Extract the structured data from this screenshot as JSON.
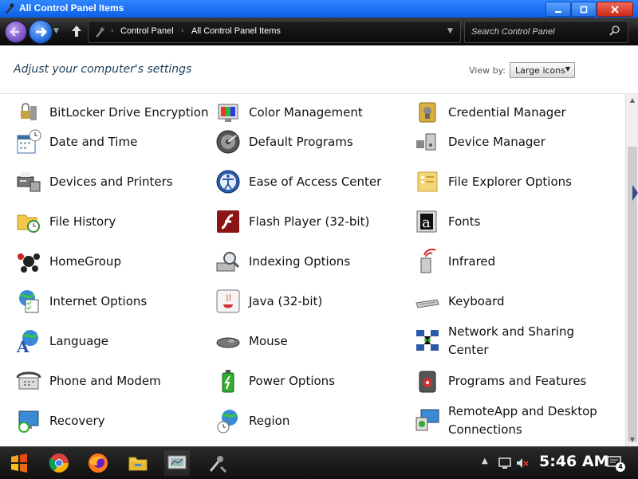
{
  "window": {
    "title": "All Control Panel Items"
  },
  "address": {
    "crumbs": [
      "Control Panel",
      "All Control Panel Items"
    ],
    "search_placeholder": "Search Control Panel"
  },
  "header": {
    "heading": "Adjust your computer's settings",
    "view_by_label": "View by:",
    "view_by_value": "Large icons"
  },
  "items": [
    {
      "label": "BitLocker Drive Encryption",
      "icon": "bitlocker-icon"
    },
    {
      "label": "Color Management",
      "icon": "color-management-icon"
    },
    {
      "label": "Credential Manager",
      "icon": "credential-manager-icon"
    },
    {
      "label": "Date and Time",
      "icon": "date-time-icon"
    },
    {
      "label": "Default Programs",
      "icon": "default-programs-icon"
    },
    {
      "label": "Device Manager",
      "icon": "device-manager-icon"
    },
    {
      "label": "Devices and Printers",
      "icon": "devices-printers-icon"
    },
    {
      "label": "Ease of Access Center",
      "icon": "ease-of-access-icon"
    },
    {
      "label": "File Explorer Options",
      "icon": "file-explorer-options-icon"
    },
    {
      "label": "File History",
      "icon": "file-history-icon"
    },
    {
      "label": "Flash Player (32-bit)",
      "icon": "flash-player-icon"
    },
    {
      "label": "Fonts",
      "icon": "fonts-icon"
    },
    {
      "label": "HomeGroup",
      "icon": "homegroup-icon"
    },
    {
      "label": "Indexing Options",
      "icon": "indexing-options-icon"
    },
    {
      "label": "Infrared",
      "icon": "infrared-icon"
    },
    {
      "label": "Internet Options",
      "icon": "internet-options-icon"
    },
    {
      "label": "Java (32-bit)",
      "icon": "java-icon"
    },
    {
      "label": "Keyboard",
      "icon": "keyboard-icon"
    },
    {
      "label": "Language",
      "icon": "language-icon"
    },
    {
      "label": "Mouse",
      "icon": "mouse-icon"
    },
    {
      "label": "Network and Sharing Center",
      "icon": "network-sharing-icon"
    },
    {
      "label": "Phone and Modem",
      "icon": "phone-modem-icon"
    },
    {
      "label": "Power Options",
      "icon": "power-options-icon"
    },
    {
      "label": "Programs and Features",
      "icon": "programs-features-icon"
    },
    {
      "label": "Recovery",
      "icon": "recovery-icon"
    },
    {
      "label": "Region",
      "icon": "region-icon"
    },
    {
      "label": "RemoteApp and Desktop Connections",
      "icon": "remoteapp-icon"
    }
  ],
  "taskbar": {
    "apps": [
      "start-icon",
      "chrome-icon",
      "firefox-icon",
      "file-explorer-icon",
      "control-panel-icon",
      "tools-icon"
    ],
    "clock": "5:46 AM",
    "notification_count": "4"
  },
  "colors": {
    "titlebar": "#1f74f0",
    "heading": "#1e3f5a",
    "taskbar": "#1a1a1a"
  }
}
